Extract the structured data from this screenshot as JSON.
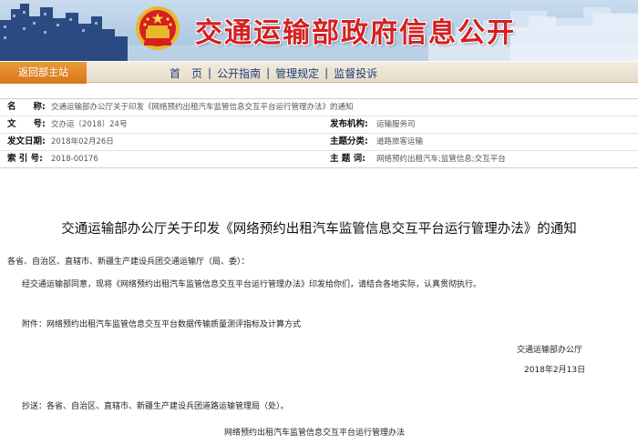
{
  "header": {
    "site_title": "交通运输部政府信息公开"
  },
  "nav": {
    "back_home": "返回部主站",
    "items": [
      {
        "label": "首　页"
      },
      {
        "label": "公开指南"
      },
      {
        "label": "管理规定"
      },
      {
        "label": "监督投诉"
      }
    ],
    "separator": "|"
  },
  "meta": {
    "rows": [
      {
        "label": "名　　称:",
        "value": "交通运输部办公厅关于印发《网络预约出租汽车监管信息交互平台运行管理办法》的通知"
      },
      {
        "label": "文　　号:",
        "value": "交办运〔2018〕24号",
        "label2": "发布机构:",
        "value2": "运输服务司"
      },
      {
        "label": "发文日期:",
        "value": "2018年02月26日",
        "label2": "主题分类:",
        "value2": "道路旅客运输"
      },
      {
        "label": "索 引 号:",
        "value": "2018-00176",
        "label2": "主 题 词:",
        "value2": "网络预约出租汽车;监管信息;交互平台"
      }
    ]
  },
  "document": {
    "title": "交通运输部办公厅关于印发《网络预约出租汽车监管信息交互平台运行管理办法》的通知",
    "salutation": "各省、自治区、直辖市、新疆生产建设兵团交通运输厅（局、委）：",
    "body": "经交通运输部同意，现将《网络预约出租汽车监管信息交互平台运行管理办法》印发给你们，请结合各地实际，认真贯彻执行。",
    "attachment": "附件：网络预约出租汽车监管信息交互平台数据传输质量测评指标及计算方式",
    "signature_org": "交通运输部办公厅",
    "signature_date": "2018年2月13日",
    "cc": "抄送：各省、自治区、直辖市、新疆生产建设兵团道路运输管理局（处）。",
    "annex_title": "网络预约出租汽车监管信息交互平台运行管理办法"
  },
  "colors": {
    "title_red": "#d42020",
    "nav_orange": "#d9761c",
    "nav_text": "#1d3f7a"
  }
}
